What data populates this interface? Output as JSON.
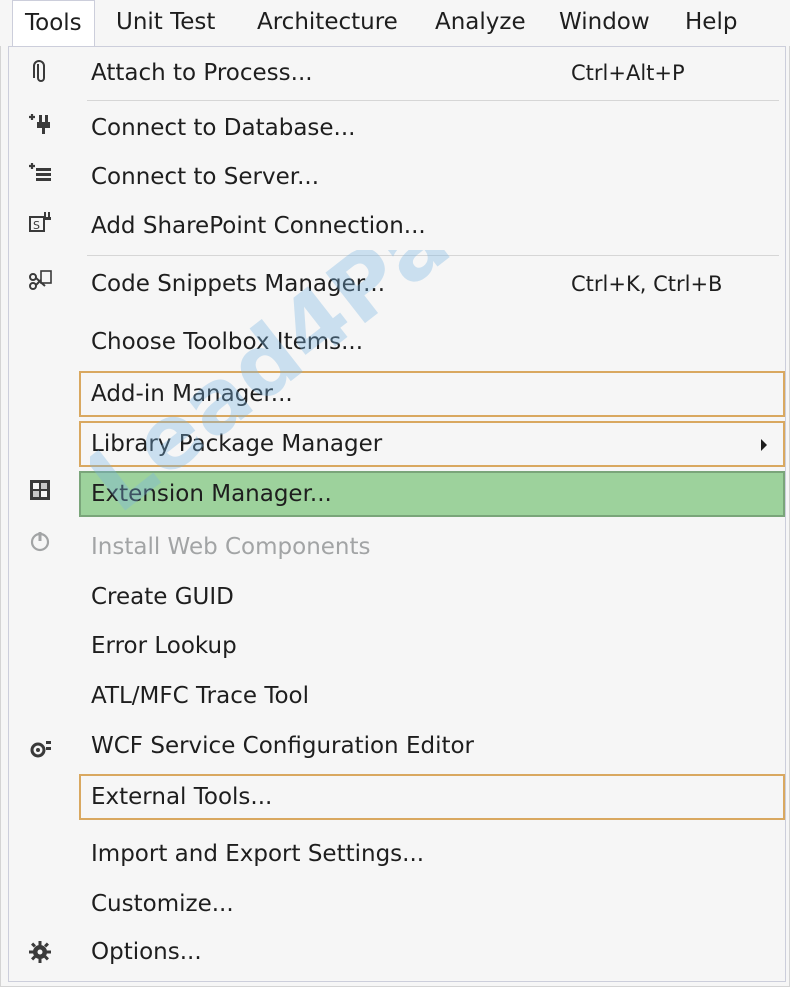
{
  "menubar": {
    "items": [
      {
        "label": "Tools",
        "active": true
      },
      {
        "label": "Unit Test"
      },
      {
        "label": "Architecture"
      },
      {
        "label": "Analyze"
      },
      {
        "label": "Window"
      },
      {
        "label": "Help"
      }
    ]
  },
  "menu": {
    "items": [
      {
        "label": "Attach to Process...",
        "shortcut": "Ctrl+Alt+P",
        "icon": "attach-icon"
      },
      {
        "label": "Connect to Database...",
        "icon": "database-connect-icon"
      },
      {
        "label": "Connect to Server...",
        "icon": "server-connect-icon"
      },
      {
        "label": "Add SharePoint Connection...",
        "icon": "sharepoint-icon"
      },
      {
        "label": "Code Snippets Manager...",
        "shortcut": "Ctrl+K, Ctrl+B",
        "icon": "snippets-icon"
      },
      {
        "label": "Choose Toolbox Items..."
      },
      {
        "label": "Add-in Manager...",
        "highlight": "outlined"
      },
      {
        "label": "Library Package Manager",
        "submenu": true,
        "highlight": "outlined"
      },
      {
        "label": "Extension Manager...",
        "highlight": "selected",
        "icon": "extension-icon"
      },
      {
        "label": "Install Web Components",
        "disabled": true,
        "icon": "power-icon"
      },
      {
        "label": "Create GUID"
      },
      {
        "label": "Error Lookup"
      },
      {
        "label": "ATL/MFC Trace Tool"
      },
      {
        "label": "WCF Service Configuration Editor",
        "icon": "wcf-config-icon"
      },
      {
        "label": "External Tools...",
        "highlight": "outlined"
      },
      {
        "label": "Import and Export Settings..."
      },
      {
        "label": "Customize..."
      },
      {
        "label": "Options...",
        "icon": "gear-icon"
      }
    ]
  },
  "watermark": {
    "text": "Lead4Pass.com"
  },
  "colors": {
    "outline": "#d9a860",
    "selected_bg": "#9dd29c",
    "disabled_text": "#a2a4a5"
  }
}
